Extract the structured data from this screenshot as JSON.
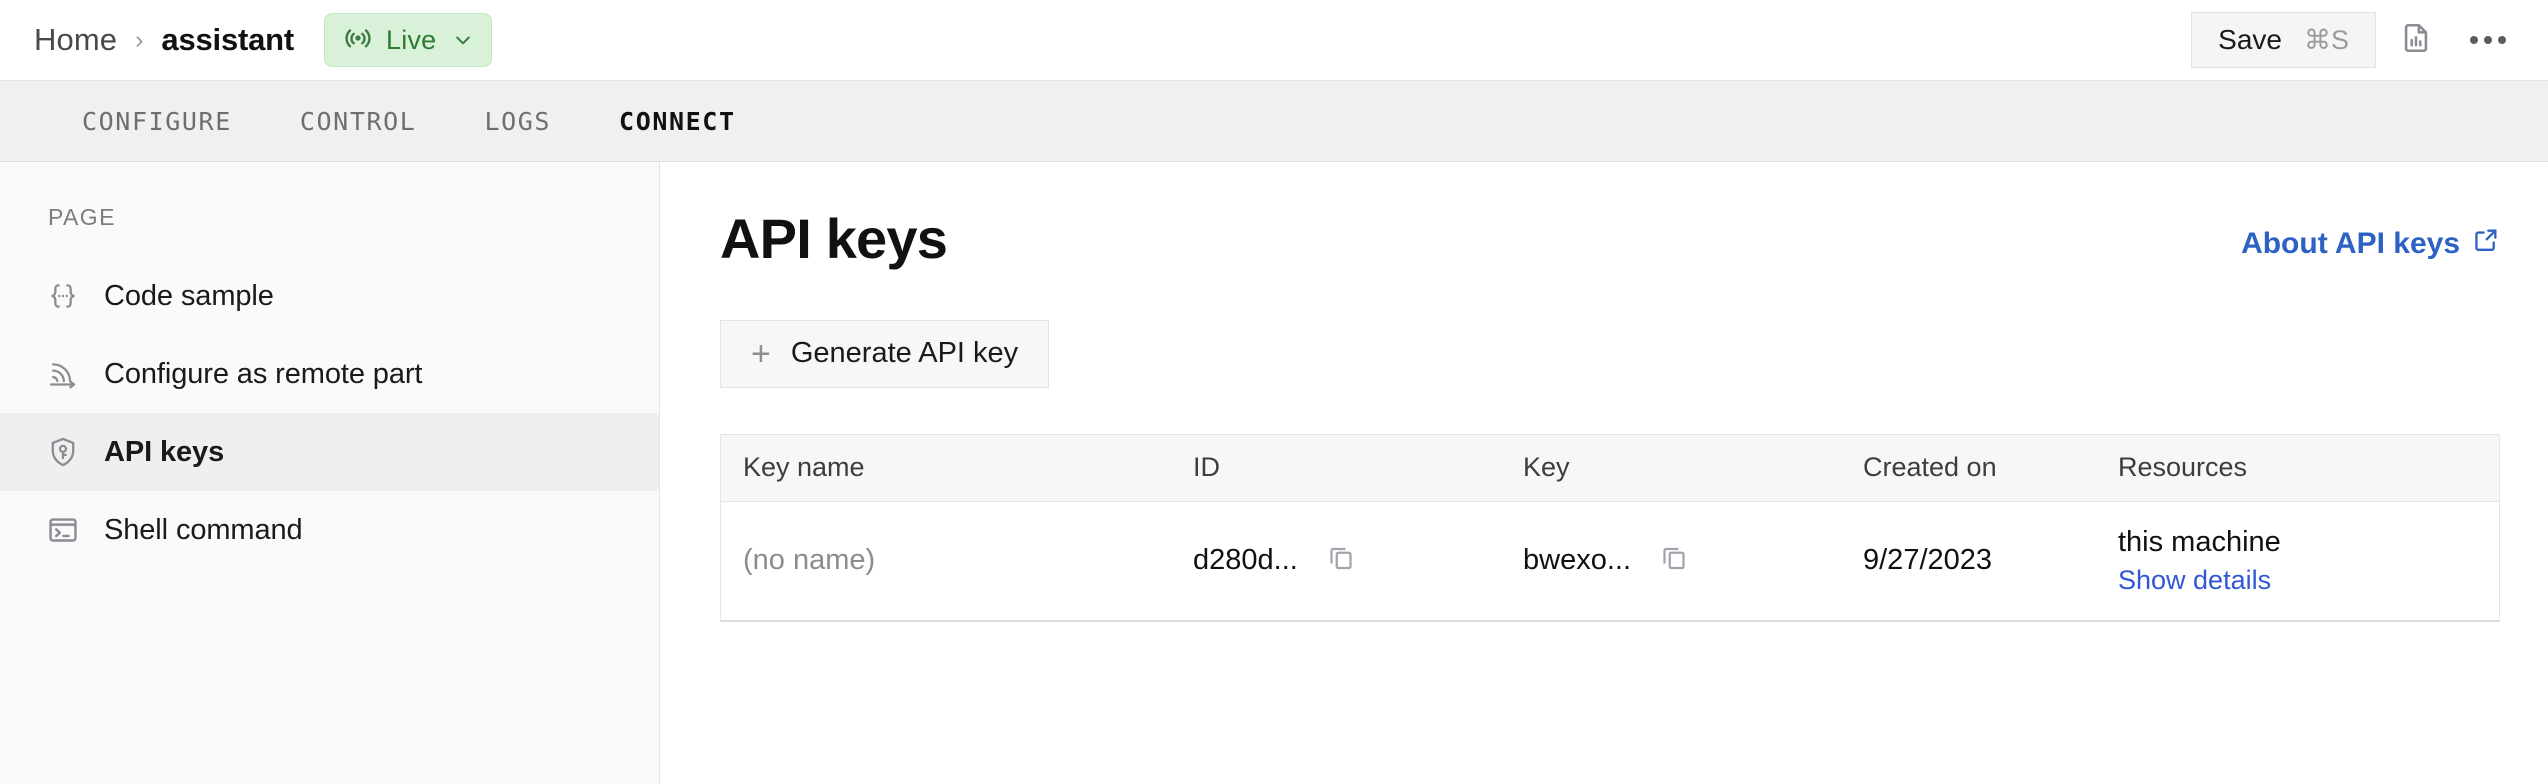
{
  "topbar": {
    "breadcrumb": {
      "home": "Home",
      "separator": "›",
      "current": "assistant"
    },
    "status_badge": {
      "label": "Live",
      "bg_color": "#d9f0d9",
      "text_color": "#2f7a33",
      "icon": "broadcast-icon",
      "chevron": "chevron-down-icon"
    },
    "save": {
      "label": "Save",
      "shortcut": "⌘S"
    },
    "report_icon": "document-chart-icon",
    "more_icon": "more-horizontal-icon"
  },
  "tabs": [
    {
      "label": "CONFIGURE",
      "active": false
    },
    {
      "label": "CONTROL",
      "active": false
    },
    {
      "label": "LOGS",
      "active": false
    },
    {
      "label": "CONNECT",
      "active": true
    }
  ],
  "sidebar": {
    "heading": "PAGE",
    "items": [
      {
        "label": "Code sample",
        "icon": "code-braces-icon",
        "active": false
      },
      {
        "label": "Configure as remote part",
        "icon": "broadcast-arrow-icon",
        "active": false
      },
      {
        "label": "API keys",
        "icon": "shield-key-icon",
        "active": true
      },
      {
        "label": "Shell command",
        "icon": "terminal-icon",
        "active": false
      }
    ]
  },
  "main": {
    "title": "API keys",
    "about_link": {
      "label": "About API keys",
      "icon": "external-link-icon",
      "color": "#2d62c4"
    },
    "generate_button": {
      "label": "Generate API key",
      "icon": "plus-icon"
    },
    "table": {
      "columns": [
        "Key name",
        "ID",
        "Key",
        "Created on",
        "Resources"
      ],
      "rows": [
        {
          "key_name": "(no name)",
          "id": "d280d...",
          "key": "bwexo...",
          "created_on": "9/27/2023",
          "resource": "this machine",
          "resource_link": "Show details",
          "copy_icon": "copy-icon"
        }
      ]
    }
  }
}
